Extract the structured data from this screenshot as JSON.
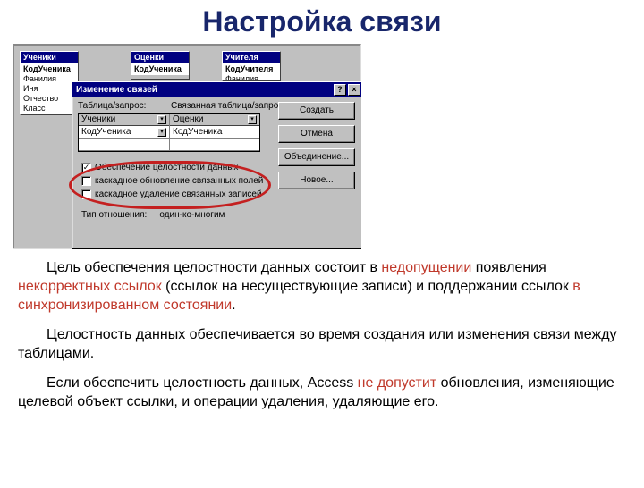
{
  "title": "Настройка связи",
  "tables": {
    "students": {
      "title": "Ученики",
      "rows": [
        "КодУченика",
        "Фанилия",
        "Иня",
        "Отчество",
        "Класс"
      ]
    },
    "grades": {
      "title": "Оценки",
      "rows": [
        "КодУченика"
      ]
    },
    "teachers": {
      "title": "Учителя",
      "rows": [
        "КодУчителя",
        "Фанилия"
      ]
    }
  },
  "dialog": {
    "title": "Изменение связей",
    "help_glyph": "?",
    "close_glyph": "×",
    "h_left": "Таблица/запрос:",
    "h_right": "Связанная таблица/запрос:",
    "left_table": "Ученики",
    "right_table": "Оценки",
    "left_field": "КодУченика",
    "right_field": "КодУченика",
    "checks": {
      "c1": "Обеспечение целостности данных",
      "c2": "каскадное обновление связанных полей",
      "c3": "каскадное удаление связанных записей",
      "c1_mark": "✓"
    },
    "relation_label": "Тип отношения:",
    "relation_value": "один-ко-многим",
    "buttons": {
      "create": "Создать",
      "cancel": "Отмена",
      "join": "Объединение...",
      "new": "Новое..."
    }
  },
  "paragraphs": {
    "p1a": "Цель обеспечения целостности данных состоит в ",
    "p1_red1": "недопущении",
    "p1b": " появления ",
    "p1_red2": "некорректных ссылок",
    "p1c": " (ссылок на несуществующие записи) и поддержании ссылок ",
    "p1_red3": "в синхронизированном состоянии",
    "p1d": ".",
    "p2": "Целостность данных обеспечивается во время создания или изменения связи между таблицами.",
    "p3a": "Если обеспечить целостность данных, Access ",
    "p3_red": "не допустит",
    "p3b": " обновления, изменяющие целевой объект ссылки, и операции удаления, удаляющие его."
  }
}
